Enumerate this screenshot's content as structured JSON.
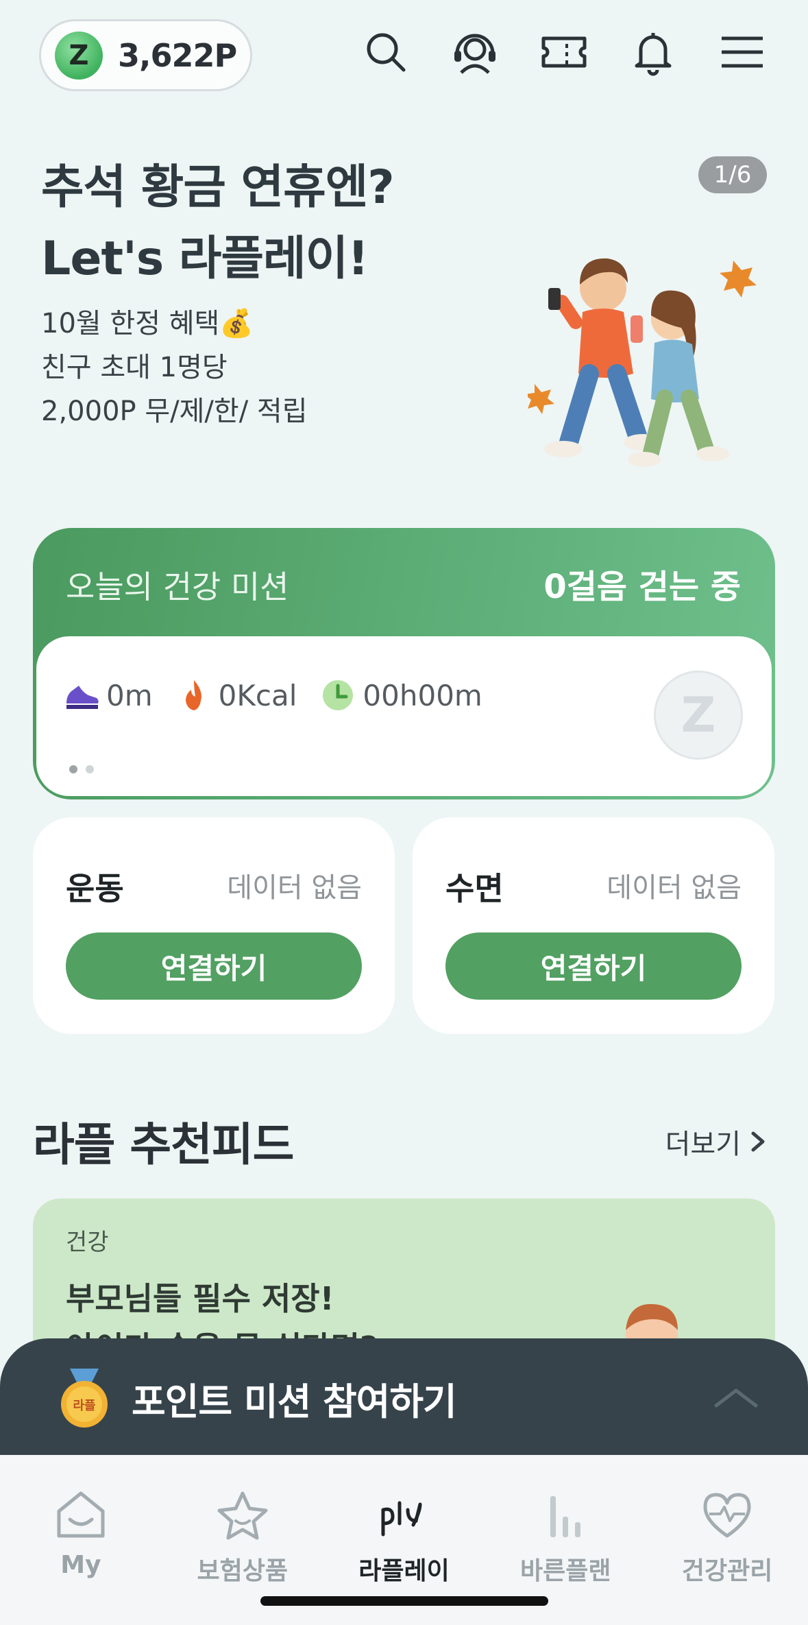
{
  "header": {
    "points_badge_letter": "Z",
    "points": "3,622P",
    "icons": [
      "search-icon",
      "support-headset-icon",
      "ticket-icon",
      "bell-icon",
      "menu-icon"
    ]
  },
  "banner": {
    "title_line1": "추석 황금 연휴엔?",
    "title_line2": "Let's 라플레이!",
    "desc_line1": "10월 한정 혜택💰",
    "desc_line2": "친구 초대 1명당",
    "desc_line3": "2,000P 무/제/한/ 적립",
    "page_indicator": "1/6"
  },
  "mission": {
    "label": "오늘의 건강 미션",
    "steps": "0걸음 걷는 중",
    "distance": "0m",
    "calories": "0Kcal",
    "duration": "00h00m",
    "watermark": "Z",
    "accent": "#52a062"
  },
  "cards": {
    "exercise": {
      "title": "운동",
      "status": "데이터 없음",
      "button": "연결하기"
    },
    "sleep": {
      "title": "수면",
      "status": "데이터 없음",
      "button": "연결하기"
    }
  },
  "feed": {
    "title": "라플 추천피드",
    "more": "더보기",
    "card": {
      "category": "건강",
      "headline1": "부모님들 필수 저장!",
      "headline2": "아이가 숨을 못 쉬다면?"
    }
  },
  "point_mission": {
    "medal_text": "라플",
    "title": "포인트 미션 참여하기"
  },
  "nav": [
    {
      "label": "My",
      "icon": "home-icon"
    },
    {
      "label": "보험상품",
      "icon": "star-icon"
    },
    {
      "label": "라플레이",
      "icon": "play-logo-icon",
      "active": true
    },
    {
      "label": "바른플랜",
      "icon": "bars-icon"
    },
    {
      "label": "건강관리",
      "icon": "heart-pulse-icon"
    }
  ]
}
